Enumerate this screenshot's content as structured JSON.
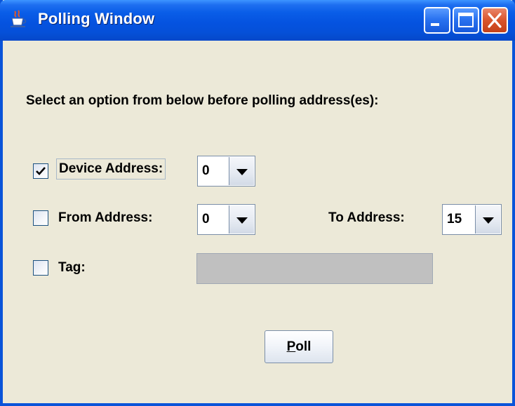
{
  "window": {
    "title": "Polling Window",
    "icon": "java-cup-icon",
    "controls": [
      "minimize-icon",
      "maximize-icon",
      "close-icon"
    ]
  },
  "instruction": "Select an option from below before polling address(es):",
  "device_address": {
    "checked": true,
    "label": "Device Address:",
    "selected": "0"
  },
  "from_address": {
    "checked": false,
    "label": "From Address:",
    "selected": "0"
  },
  "to_address": {
    "label": "To Address:",
    "selected": "15"
  },
  "tag": {
    "checked": false,
    "label": "Tag:",
    "value": ""
  },
  "poll_button": {
    "mnemonic": "P",
    "rest": "oll"
  },
  "colors": {
    "titlebar": "#0553E0",
    "window_bg": "#ECE9D8",
    "close_button": "#D9542B",
    "disabled_field": "#C0C0C0"
  }
}
